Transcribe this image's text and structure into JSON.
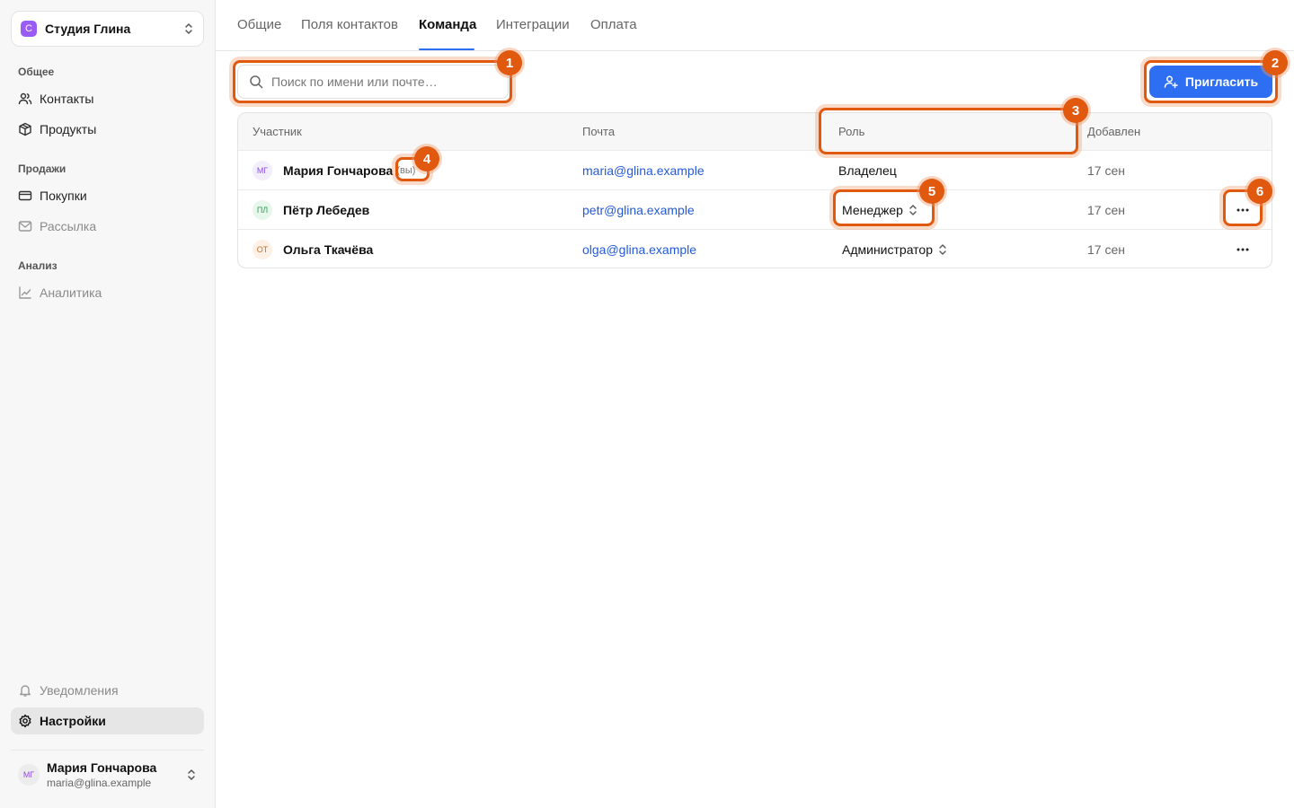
{
  "workspace": {
    "logo_letter": "С",
    "name": "Студия Глина",
    "logo_color": "#9b5cf6"
  },
  "sidebar": {
    "groups": [
      {
        "label": "Общее",
        "items": [
          {
            "label": "Контакты",
            "icon": "users-icon"
          },
          {
            "label": "Продукты",
            "icon": "box-icon"
          }
        ]
      },
      {
        "label": "Продажи",
        "items": [
          {
            "label": "Покупки",
            "icon": "card-icon"
          },
          {
            "label": "Рассылка",
            "icon": "mail-icon"
          }
        ]
      },
      {
        "label": "Анализ",
        "items": [
          {
            "label": "Аналитика",
            "icon": "chart-line-icon"
          }
        ]
      }
    ],
    "bottom": [
      {
        "label": "Уведомления",
        "icon": "bell-icon"
      },
      {
        "label": "Настройки",
        "icon": "gear-icon",
        "active": true
      }
    ]
  },
  "user": {
    "initials": "МГ",
    "name": "Мария Гончарова",
    "email": "maria@glina.example"
  },
  "tabs": [
    {
      "label": "Общие"
    },
    {
      "label": "Поля контактов"
    },
    {
      "label": "Команда",
      "active": true
    },
    {
      "label": "Интеграции"
    },
    {
      "label": "Оплата"
    }
  ],
  "search": {
    "placeholder": "Поиск по имени или почте…",
    "value": ""
  },
  "invite_button": {
    "label": "Пригласить"
  },
  "table": {
    "columns": [
      "Участник",
      "Почта",
      "Роль",
      "Добавлен"
    ],
    "rows": [
      {
        "initials": "МГ",
        "name": "Мария Гончарова",
        "you_tag": "(вы)",
        "email": "maria@glina.example",
        "role": "Владелец",
        "role_editable": false,
        "added": "17 сен",
        "avatar_bg": "#f3eefc",
        "avatar_fg": "#8a4fe0"
      },
      {
        "initials": "ПЛ",
        "name": "Пётр Лебедев",
        "email": "petr@glina.example",
        "role": "Менеджер",
        "role_editable": true,
        "added": "17 сен",
        "avatar_bg": "#e7f7ec",
        "avatar_fg": "#2f9a55"
      },
      {
        "initials": "ОТ",
        "name": "Ольга Ткачёва",
        "email": "olga@glina.example",
        "role": "Администратор",
        "role_editable": true,
        "added": "17 сен",
        "avatar_bg": "#fdf0e4",
        "avatar_fg": "#c2722d"
      }
    ]
  },
  "annotations": [
    "1",
    "2",
    "3",
    "4",
    "5",
    "6"
  ],
  "colors": {
    "accent": "#2d6ef2",
    "annotation": "#e1580f",
    "link": "#2459d8"
  }
}
